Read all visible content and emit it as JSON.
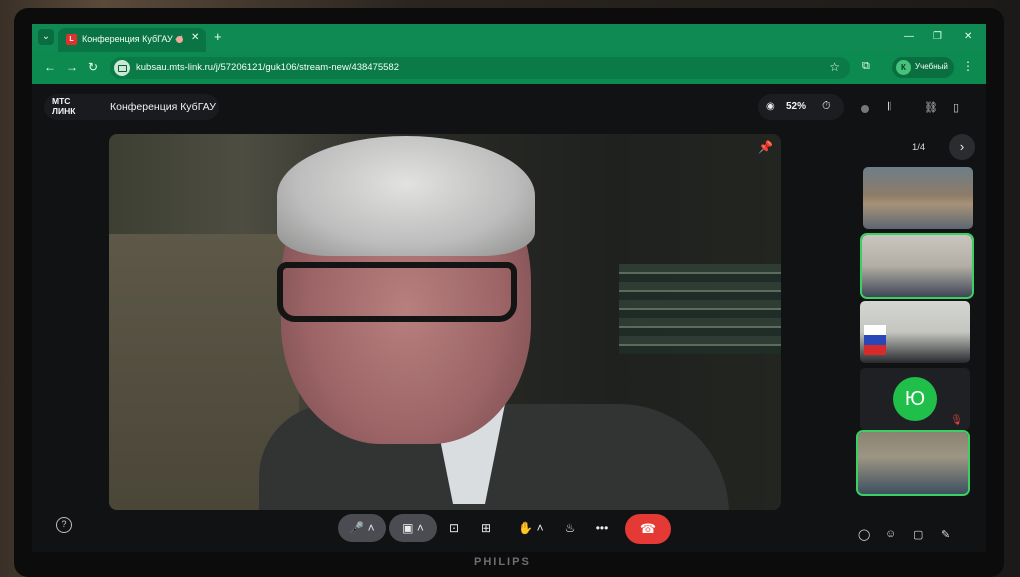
{
  "browser": {
    "tab_title": "Конференция КубГАУ - МТС",
    "new_tab": "+",
    "url": "kubsau.mts-link.ru/j/57206121/guk106/stream-new/438475582",
    "profile_initial": "К",
    "profile_name": "Учебный"
  },
  "app": {
    "logo_top": "МТС",
    "logo_bottom": "ЛИНК",
    "conference_name": "Конференция КубГАУ",
    "audience_percent": "52%"
  },
  "participants": {
    "pager": "1/4",
    "avatar_initial": "Ю"
  },
  "monitor": {
    "brand": "PHILIPS"
  },
  "colors": {
    "browser_accent": "#0e8a52",
    "hangup": "#e53935",
    "active_speaker": "#3ad062",
    "avatar": "#1fbf4a"
  },
  "icons": [
    "search-icon",
    "close-icon",
    "back-icon",
    "forward-icon",
    "reload-icon",
    "star-icon",
    "extensions-icon",
    "menu-icon",
    "eye-icon",
    "timer-icon",
    "record-icon",
    "audio-icon",
    "link-icon",
    "layout-icon",
    "pin-icon",
    "chevron-right-icon",
    "mic-icon",
    "camera-icon",
    "share-screen-icon",
    "apps-icon",
    "hand-icon",
    "reaction-icon",
    "more-icon",
    "hangup-icon",
    "chat-icon",
    "people-icon",
    "files-icon",
    "notes-icon",
    "help-icon"
  ]
}
